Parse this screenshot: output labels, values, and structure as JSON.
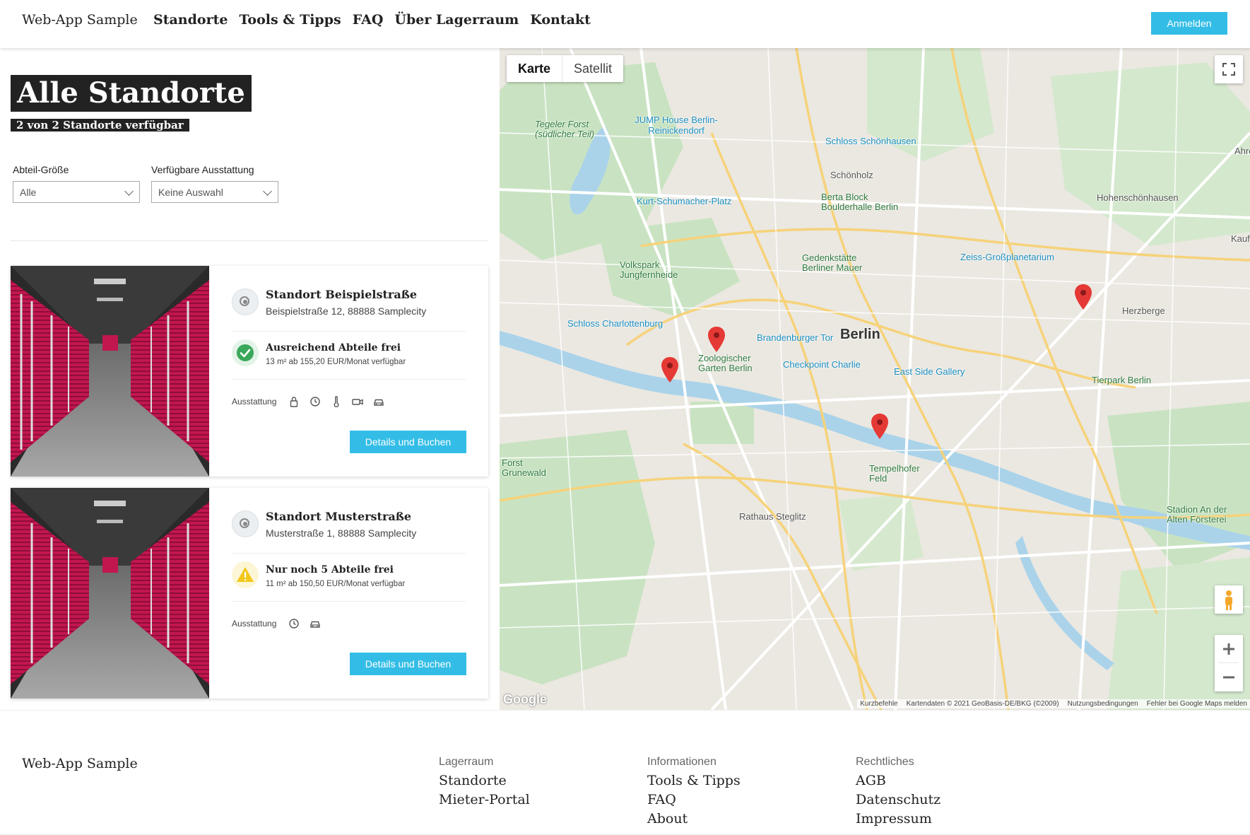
{
  "header": {
    "brand": "Web-App Sample",
    "nav": [
      "Standorte",
      "Tools & Tipps",
      "FAQ",
      "Über Lagerraum",
      "Kontakt"
    ],
    "login_label": "Anmelden"
  },
  "page": {
    "title": "Alle Standorte",
    "subtitle": "2 von 2 Standorte verfügbar"
  },
  "filters": {
    "size_label": "Abteil-Größe",
    "size_value": "Alle",
    "features_label": "Verfügbare Ausstattung",
    "features_value": "Keine Auswahl"
  },
  "locations": [
    {
      "name": "Standort Beispielstraße",
      "address": "Beispielstraße 12, 88888 Samplecity",
      "status": "Ausreichend Abteile frei",
      "status_detail": "13 m² ab 155,20 EUR/Monat verfügbar",
      "status_color": "#3aa85a",
      "amenities_label": "Ausstattung",
      "amenities": [
        "lock-icon",
        "clock-icon",
        "thermometer-icon",
        "camera-icon",
        "car-icon"
      ],
      "button": "Details und Buchen"
    },
    {
      "name": "Standort Musterstraße",
      "address": "Musterstraße 1, 88888 Samplecity",
      "status": "Nur noch 5 Abteile frei",
      "status_detail": "11 m² ab 150,50 EUR/Monat verfügbar",
      "status_color": "#f2c71b",
      "amenities_label": "Ausstattung",
      "amenities": [
        "clock-icon",
        "car-icon"
      ],
      "button": "Details und Buchen"
    }
  ],
  "map": {
    "type_options": [
      "Karte",
      "Satellit"
    ],
    "selected_type": "Karte",
    "city_label": "Berlin",
    "labels": {
      "jump": "JUMP House Berlin-Reinickendorf",
      "schloss_schoenhausen": "Schloss Schönhausen",
      "schoenholz": "Schönholz",
      "tegeler_forst": "Tegeler Forst (südlicher Teil)",
      "kurt": "Kurt-Schumacher-Platz",
      "berta": "Berta Block Boulderhalle Berlin",
      "hohenschoenhausen": "Hohenschönhausen",
      "volkspark": "Volkspark Jungfernheide",
      "gedenk": "Gedenkstätte Berliner Mauer",
      "zeiss": "Zeiss-Großplanetarium",
      "herzberge": "Herzberge",
      "schloss_charl": "Schloss Charlottenburg",
      "brandenburger": "Brandenburger Tor",
      "zoo": "Zoologischer Garten Berlin",
      "checkpoint": "Checkpoint Charlie",
      "eastside": "East Side Gallery",
      "tierpark": "Tierpark Berlin",
      "forst_grunewald": "Forst Grunewald",
      "tempelhofer": "Tempelhofer Feld",
      "rathaus": "Rathaus Steglitz",
      "stadion": "Stadion An der Alten Försterei",
      "ahrensfelde": "Ahre",
      "kauf": "Kauf"
    },
    "attribution": [
      "Kurzbefehle",
      "Kartendaten © 2021 GeoBasis-DE/BKG (©2009)",
      "Nutzungsbedingungen",
      "Fehler bei Google Maps melden"
    ],
    "logo": "Google"
  },
  "footer": {
    "brand": "Web-App Sample",
    "columns": [
      {
        "heading": "Lagerraum",
        "links": [
          "Standorte",
          "Mieter-Portal"
        ]
      },
      {
        "heading": "Informationen",
        "links": [
          "Tools & Tipps",
          "FAQ",
          "About"
        ]
      },
      {
        "heading": "Rechtliches",
        "links": [
          "AGB",
          "Datenschutz",
          "Impressum"
        ]
      }
    ]
  }
}
